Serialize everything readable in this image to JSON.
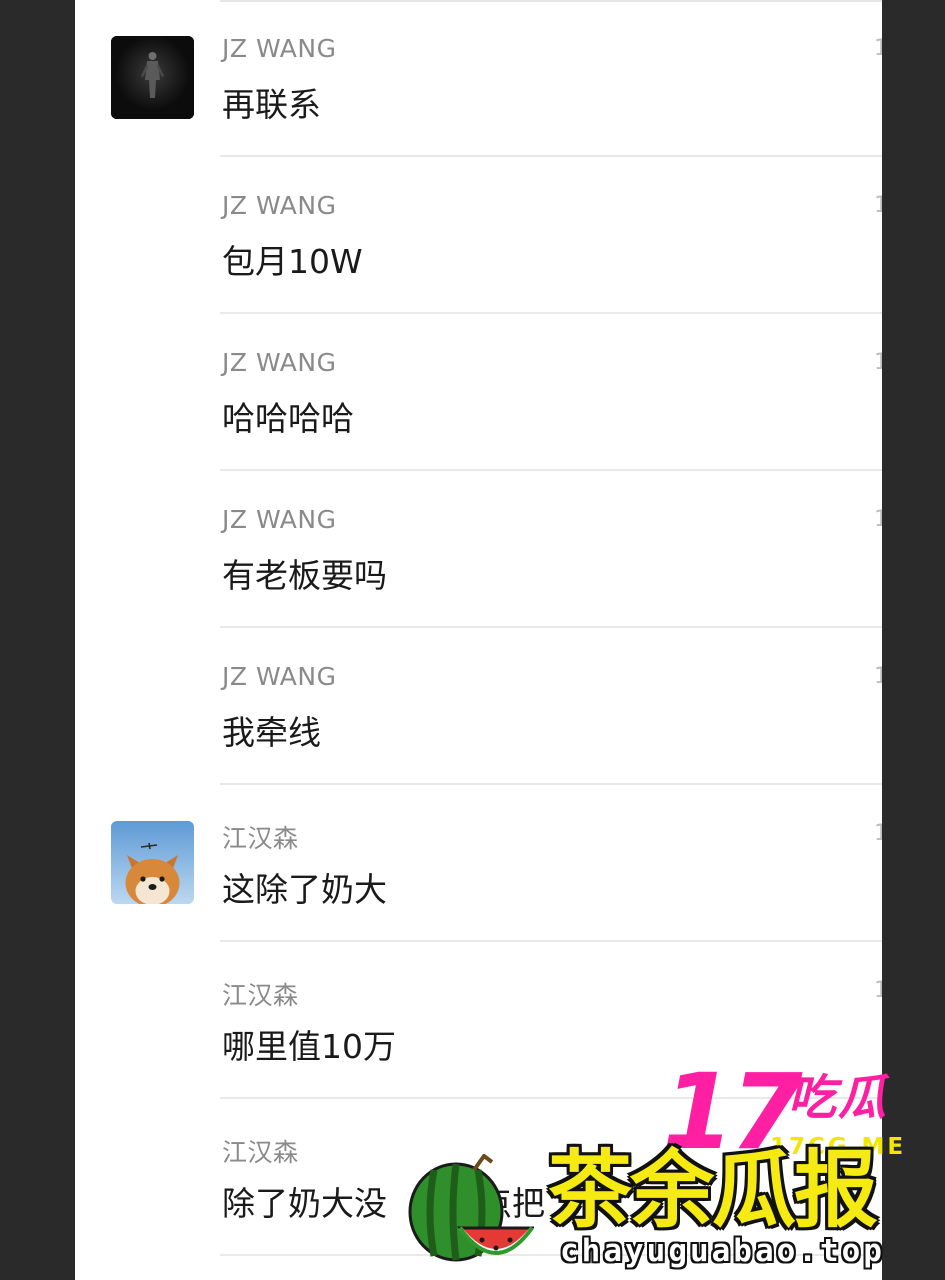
{
  "messages": [
    {
      "sender": "JZ WANG",
      "text": "再联系",
      "time": "1",
      "avatar": "dark-figure-avatar"
    },
    {
      "sender": "JZ WANG",
      "text": "包月10W",
      "time": "1"
    },
    {
      "sender": "JZ WANG",
      "text": "哈哈哈哈",
      "time": "1"
    },
    {
      "sender": "JZ WANG",
      "text": "有老板要吗",
      "time": "1"
    },
    {
      "sender": "JZ WANG",
      "text": "我牵线",
      "time": "1"
    },
    {
      "sender": "江汉森",
      "text": "这除了奶大",
      "time": "1",
      "avatar": "shiba-dog-avatar"
    },
    {
      "sender": "江汉森",
      "text": "哪里值10万",
      "time": "1"
    },
    {
      "sender": "江汉森",
      "text": "除了奶大没",
      "text_tail": "点把",
      "time": ""
    }
  ],
  "watermark": {
    "brand_number": "17",
    "brand_text": "吃瓜",
    "brand_site": "17CG.ME",
    "title": "茶余瓜报",
    "domain": "chayuguabao.top",
    "icon": "watermelon-icon",
    "colors": {
      "pink": "#ff1fa3",
      "yellow": "#f5ea12"
    }
  },
  "colors": {
    "background": "#2b2a2b",
    "panel": "#ffffff",
    "sender": "#8a8a8a",
    "text": "#1a1a1a",
    "divider": "#e9e9e9"
  }
}
